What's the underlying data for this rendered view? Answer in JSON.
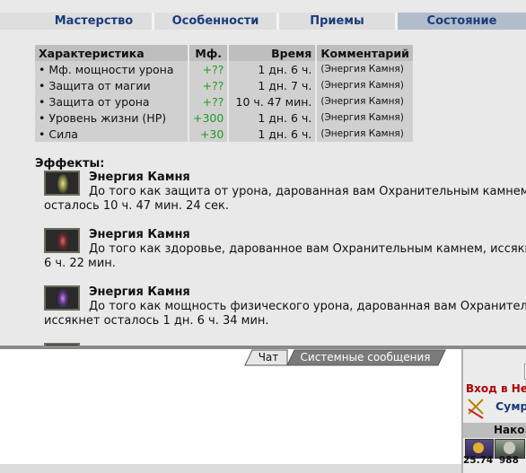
{
  "tabs": [
    "Мастерство",
    "Особенности",
    "Приемы",
    "Состояние"
  ],
  "table": {
    "headers": [
      "Характеристика",
      "Мф.",
      "Время",
      "Комментарий"
    ],
    "rows": [
      {
        "name": "• Мф. мощности урона",
        "mf": "+??",
        "time": "1 дн. 6 ч.",
        "comment": "(Энергия Камня)"
      },
      {
        "name": "• Защита от магии",
        "mf": "+??",
        "time": "1 дн. 7 ч.",
        "comment": "(Энергия Камня)"
      },
      {
        "name": "• Защита от урона",
        "mf": "+??",
        "time": "10 ч. 47 мин.",
        "comment": "(Энергия Камня)"
      },
      {
        "name": "• Уровень жизни (HP)",
        "mf": "+300",
        "time": "1 дн. 6 ч.",
        "comment": "(Энергия Камня)"
      },
      {
        "name": "• Сила",
        "mf": "+30",
        "time": "1 дн. 6 ч.",
        "comment": "(Энергия Камня)"
      }
    ]
  },
  "effects_title": "Эффекты:",
  "effects": [
    {
      "name": "Энергия Камня",
      "line1": "До того как защита от урона, дарованная вам Охранительным камнем",
      "line2": "осталось 10 ч. 47 мин. 24 сек.",
      "color": "#c8c060"
    },
    {
      "name": "Энергия Камня",
      "line1": "До того как здоровье, дарованное вам Охранительным камнем, иссякн",
      "line2": "6 ч. 22 мин.",
      "color": "#b04040"
    },
    {
      "name": "Энергия Камня",
      "line1": "До того как мощность физического урона, дарованная вам Охранител",
      "line2": "иссякнет осталось 1 дн. 6 ч. 34 мин.",
      "color": "#8a50b0"
    }
  ],
  "chat": {
    "tab_chat": "Чат",
    "tab_system": "Системные сообщения"
  },
  "right_panel": {
    "red_text": "Вход в Не",
    "link_text": "Сумр",
    "tab_label": "Нако",
    "val1": "25.74",
    "val2": "988"
  }
}
